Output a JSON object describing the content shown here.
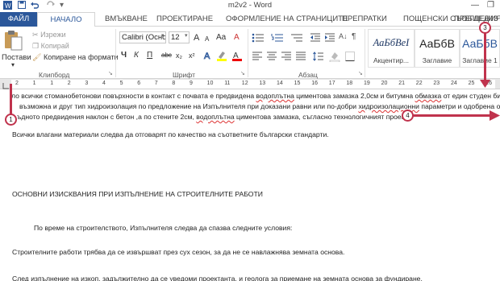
{
  "window": {
    "title": "m2v2 - Word",
    "minimize": "—",
    "restore": "❐"
  },
  "qat": {
    "save_icon": "save-icon",
    "undo_icon": "undo-icon",
    "redo_icon": "redo-icon",
    "customize": "▾"
  },
  "tabs": [
    {
      "label": "ФАЙЛ"
    },
    {
      "label": "НАЧАЛО"
    },
    {
      "label": "ВМЪКВАНЕ"
    },
    {
      "label": "ПРОЕКТИРАНЕ"
    },
    {
      "label": "ОФОРМЛЕНИЕ НА СТРАНИЦИТЕ"
    },
    {
      "label": "ПРЕПРАТКИ"
    },
    {
      "label": "ПОЩЕНСКИ СЪОБЩЕНИЯ"
    },
    {
      "label": "ПРЕГЛЕД"
    },
    {
      "label": "ИЗ"
    }
  ],
  "clipboard": {
    "paste": "Постави",
    "paste_arrow": "▾",
    "cut": "Изрежи",
    "copy": "Копирай",
    "format_painter": "Копиране на формати",
    "label": "Клипборд"
  },
  "font": {
    "name": "Calibri (Осно",
    "size": "12",
    "grow": "A",
    "shrink": "A",
    "case": "Aa",
    "clear": "A",
    "bold": "Ч",
    "italic": "К",
    "underline": "П",
    "strike": "abc",
    "sub": "x₂",
    "sup": "x²",
    "label": "Шрифт"
  },
  "paragraph": {
    "label": "Абзац"
  },
  "styles": [
    {
      "sample": "АаБбВеІ",
      "name": "Акцентир..."
    },
    {
      "sample": "АаБбВ",
      "name": "Заглавие"
    },
    {
      "sample": "АаБбВ",
      "name": "Заглавие 1"
    }
  ],
  "ruler": {
    "numbers": [
      "2",
      "1",
      "1",
      "2",
      "3",
      "4",
      "5",
      "6",
      "7",
      "8",
      "9",
      "10",
      "11",
      "12",
      "13",
      "14",
      "15",
      "16",
      "17",
      "18",
      "19",
      "20",
      "21",
      "22",
      "23",
      "24",
      "25",
      "26",
      "27"
    ]
  },
  "document": {
    "lines": [
      {
        "pre": "ло всички стоманобетонови повърхности в контакт с почвата е предвидена ",
        "err": "водоплътна",
        "post": " циментова замазка 2,0см и битумна ",
        "err2": "обмазка",
        "post2": " от един студен битум"
      },
      {
        "pre": "възможна и друг тип хидроизолация по предложение на Изпълнителя при доказани равни или по-добри  ",
        "err": "хидроизолационни",
        "post": " параметри и одобрена от"
      },
      {
        "pre": "ъдното предвидения наклон с бетон ,а по стените 2см, ",
        "err": "водоплътна",
        "post": " циментова замазка, съгласно технологичният проект."
      },
      {
        "pre": "Всички влагани материали следва да отговарят по качество на съответните български стандарти."
      },
      {
        "pre": "ОСНОВНИ ИЗИСКВАНИЯ ПРИ ИЗПЪЛНЕНИЕ НА СТРОИТЕЛНИТЕ РАБОТИ"
      },
      {
        "pre": "По време на строителството, Изпълнителя следва да спазва следните условия:"
      },
      {
        "pre": "Строителните работи трябва да се извършват през сух сезон, за да не се навлажнява земната основа."
      },
      {
        "pre": "След изпълнение на изкоп, задължително да се уведоми проектанта, и геолога за приемане на земната основа за фундиране."
      }
    ]
  },
  "annotations": [
    {
      "label": "1"
    },
    {
      "label": "3"
    },
    {
      "label": "4"
    }
  ],
  "colors": {
    "accent": "#2b579a",
    "annotation": "#c0334d"
  }
}
